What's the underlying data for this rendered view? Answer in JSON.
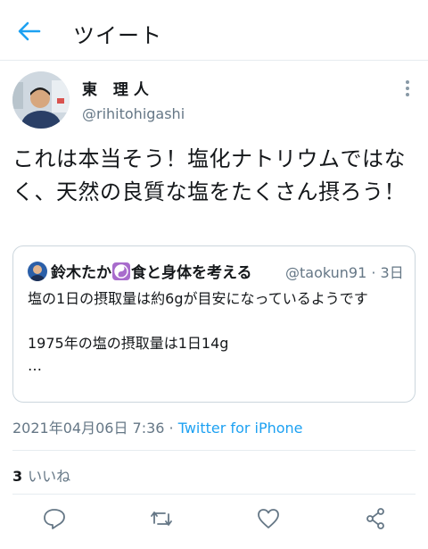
{
  "header": {
    "title": "ツイート",
    "back_icon": "arrow-left-icon"
  },
  "author": {
    "display_name": "東 理人",
    "handle": "@rihitohigashi"
  },
  "tweet": {
    "text": "これは本当そう！塩化ナトリウムではなく、天然の良質な塩をたくさん摂ろう！"
  },
  "quoted": {
    "name_before": "鈴木たか",
    "name_after": "食と身体を考える",
    "handle_time": "@taokun91 · 3日",
    "line1": "塩の1日の摂取量は約6gが目安になっているようです",
    "line2": "1975年の塩の摂取量は1日14g",
    "line3": "…"
  },
  "meta": {
    "timestamp": "2021年04月06日 7:36 · ",
    "source": "Twitter for iPhone"
  },
  "stats": {
    "like_count": "3",
    "like_label": "いいね"
  },
  "actions": [
    "reply-icon",
    "retweet-icon",
    "like-icon",
    "share-icon"
  ],
  "colors": {
    "accent": "#1da1f2",
    "secondary_text": "#657786",
    "border": "#ccd6dd"
  }
}
